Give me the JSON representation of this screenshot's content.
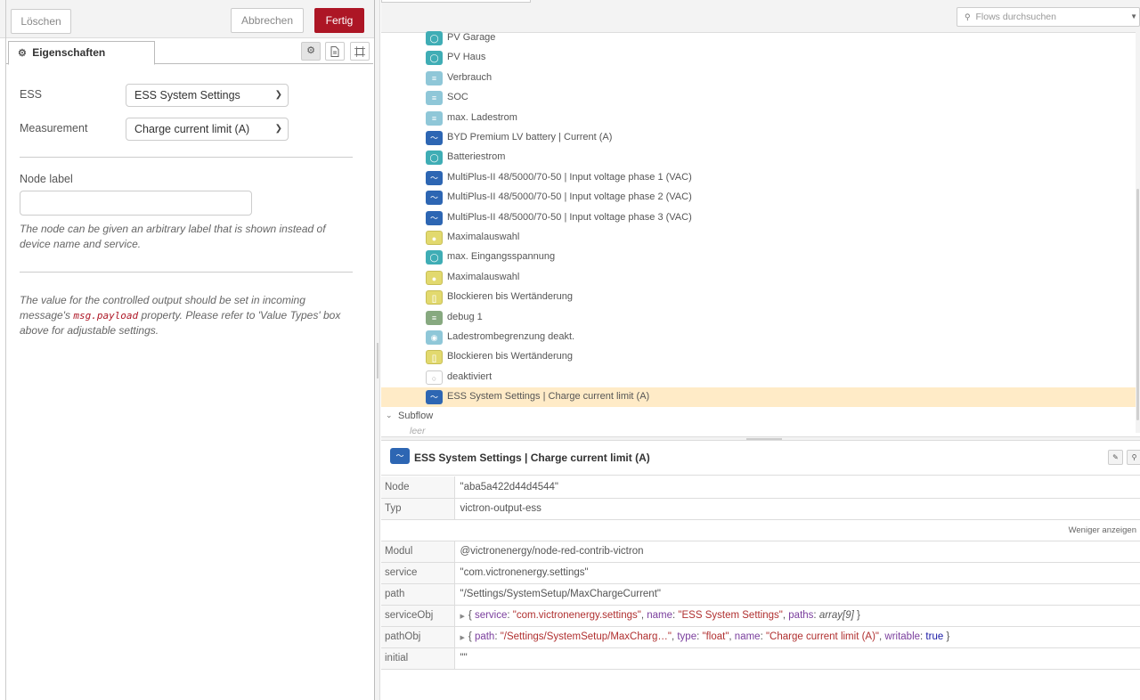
{
  "tray": {
    "delete_label": "Löschen",
    "cancel_label": "Abbrechen",
    "done_label": "Fertig",
    "tab_label": "Eigenschaften"
  },
  "form": {
    "ess_label": "ESS",
    "ess_value": "ESS System Settings",
    "measurement_label": "Measurement",
    "measurement_value": "Charge current limit (A)",
    "node_label_label": "Node label",
    "node_label_value": "",
    "help_label": "The node can be given an arbitrary label that is shown instead of device name and service.",
    "help_value_pre": "The value for the controlled output should be set in incoming message's ",
    "help_value_code": "msg.payload",
    "help_value_post": " property. Please refer to 'Value Types' box above for adjustable settings."
  },
  "outline": {
    "search_placeholder": "Flows durchsuchen",
    "items": [
      {
        "label": "PV Garage",
        "icon": "gauge-icon",
        "color": "teal"
      },
      {
        "label": "PV Haus",
        "icon": "gauge-icon",
        "color": "teal"
      },
      {
        "label": "Verbrauch",
        "icon": "bars-icon",
        "color": "light"
      },
      {
        "label": "SOC",
        "icon": "bars-icon",
        "color": "light"
      },
      {
        "label": "max. Ladestrom",
        "icon": "bars-icon",
        "color": "light"
      },
      {
        "label": "BYD Premium LV battery | Current (A)",
        "icon": "victron-icon",
        "color": "blue"
      },
      {
        "label": "Batteriestrom",
        "icon": "gauge-icon",
        "color": "teal"
      },
      {
        "label": "MultiPlus-II 48/5000/70-50 | Input voltage phase 1 (VAC)",
        "icon": "victron-icon",
        "color": "blue"
      },
      {
        "label": "MultiPlus-II 48/5000/70-50 | Input voltage phase 2 (VAC)",
        "icon": "victron-icon",
        "color": "blue"
      },
      {
        "label": "MultiPlus-II 48/5000/70-50 | Input voltage phase 3 (VAC)",
        "icon": "victron-icon",
        "color": "blue"
      },
      {
        "label": "Maximalauswahl",
        "icon": "function-icon",
        "color": "yellow"
      },
      {
        "label": "max. Eingangsspannung",
        "icon": "gauge-icon",
        "color": "teal"
      },
      {
        "label": "Maximalauswahl",
        "icon": "function-icon",
        "color": "yellow"
      },
      {
        "label": "Blockieren bis Wertänderung",
        "icon": "filter-icon",
        "color": "yellow"
      },
      {
        "label": "debug 1",
        "icon": "debug-icon",
        "color": "green"
      },
      {
        "label": "Ladestrombegrenzung deakt.",
        "icon": "toggle-icon",
        "color": "light"
      },
      {
        "label": "Blockieren bis Wertänderung",
        "icon": "filter-icon",
        "color": "yellow"
      },
      {
        "label": "deaktiviert",
        "icon": "comment-icon",
        "color": "empty"
      },
      {
        "label": "ESS System Settings | Charge current limit (A)",
        "icon": "victron-icon",
        "color": "blue",
        "selected": true
      }
    ],
    "subflow_label": "Subflow",
    "subflow_empty": "leer"
  },
  "info": {
    "title": "ESS System Settings | Charge current limit (A)",
    "rows": {
      "node_k": "Node",
      "node_v": "\"aba5a422d44d4544\"",
      "typ_k": "Typ",
      "typ_v": "victron-output-ess",
      "less": "Weniger anzeigen",
      "modul_k": "Modul",
      "modul_v": "@victronenergy/node-red-contrib-victron",
      "service_k": "service",
      "service_v": "\"com.victronenergy.settings\"",
      "path_k": "path",
      "path_v": "\"/Settings/SystemSetup/MaxChargeCurrent\"",
      "serviceobj_k": "serviceObj",
      "serviceobj": {
        "k1": "service",
        "v1": "\"com.victronenergy.settings\"",
        "k2": "name",
        "v2": "\"ESS System Settings\"",
        "k3": "paths",
        "v3": "array[9]"
      },
      "pathobj_k": "pathObj",
      "pathobj": {
        "k1": "path",
        "v1": "\"/Settings/SystemSetup/MaxCharg…\"",
        "k2": "type",
        "v2": "\"float\"",
        "k3": "name",
        "v3": "\"Charge current limit (A)\"",
        "k4": "writable",
        "v4": "true"
      },
      "initial_k": "initial",
      "initial_v": "\"\""
    }
  },
  "colors": {
    "done_button": "#ad1625",
    "selected_row": "#ffebc7",
    "victron_blue": "#2d66b3",
    "teal": "#3fadb5"
  }
}
